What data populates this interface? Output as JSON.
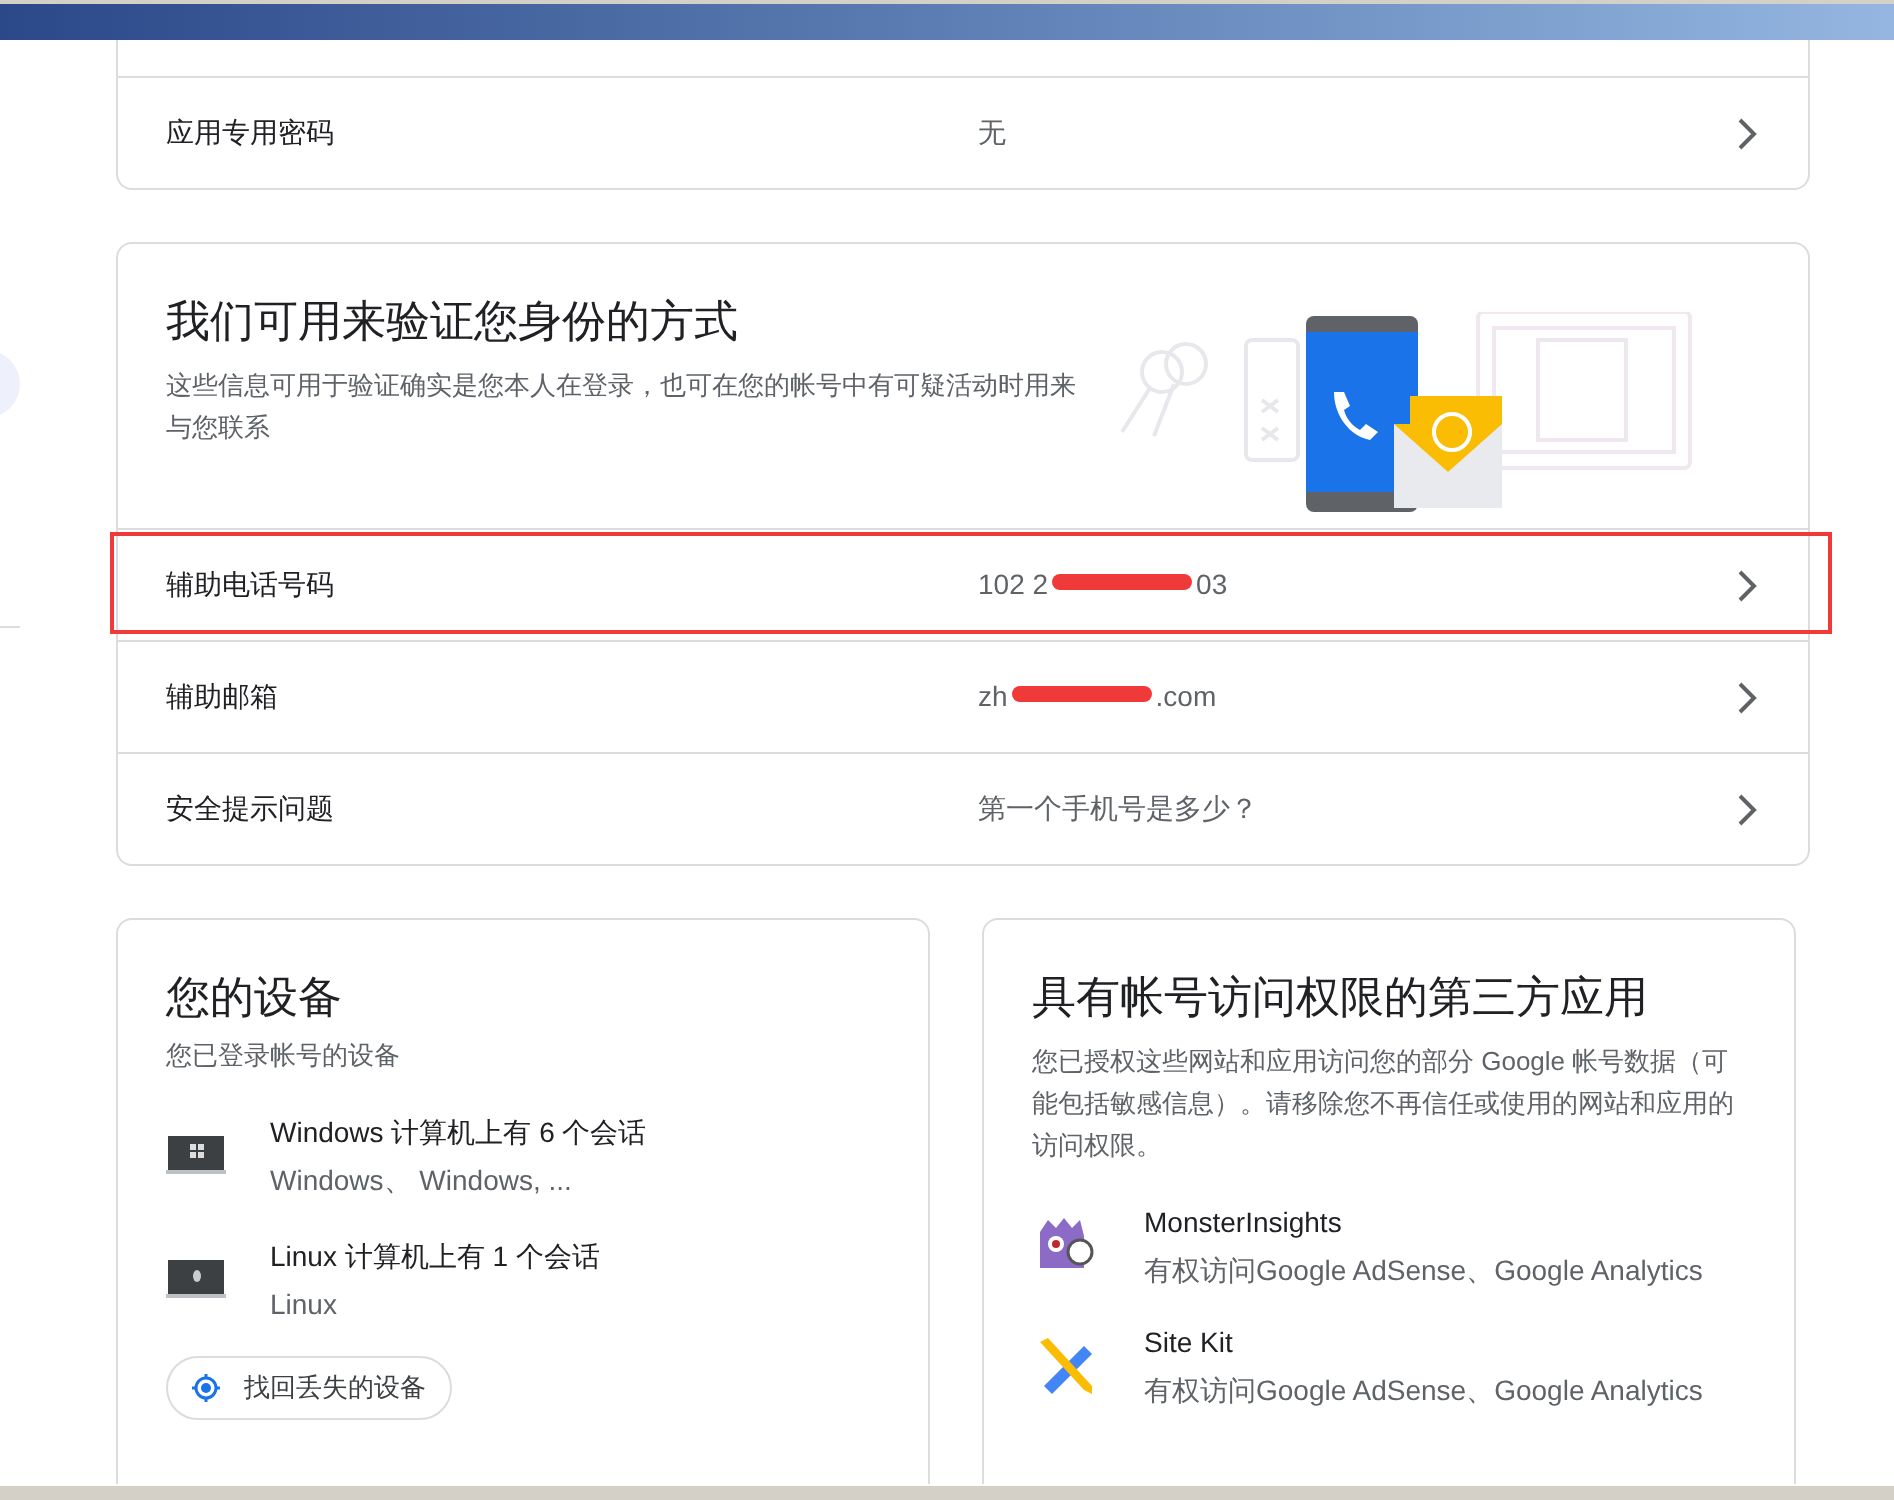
{
  "top_card": {
    "rows": [
      {
        "label": "应用专用密码",
        "value": "无"
      }
    ]
  },
  "verify_card": {
    "title": "我们可用来验证您身份的方式",
    "description": "这些信息可用于验证确实是您本人在登录，也可在您的帐号中有可疑活动时用来与您联系",
    "rows": [
      {
        "label": "辅助电话号码",
        "value_start": "102 2",
        "value_end": "03",
        "redacted": true,
        "highlighted": true
      },
      {
        "label": "辅助邮箱",
        "value_start": "zh",
        "value_end": ".com",
        "redacted": true,
        "highlighted": false
      },
      {
        "label": "安全提示问题",
        "value_start": "第一个手机号是多少？",
        "value_end": "",
        "redacted": false,
        "highlighted": false
      }
    ]
  },
  "devices_card": {
    "title": "您的设备",
    "subtitle": "您已登录帐号的设备",
    "devices": [
      {
        "kind": "windows",
        "title": "Windows 计算机上有 6 个会话",
        "detail": "Windows、 Windows, ..."
      },
      {
        "kind": "linux",
        "title": "Linux 计算机上有 1 个会话",
        "detail": "Linux"
      }
    ],
    "button": "找回丢失的设备"
  },
  "apps_card": {
    "title": "具有帐号访问权限的第三方应用",
    "description": "您已授权这些网站和应用访问您的部分 Google 帐号数据（可能包括敏感信息）。请移除您不再信任或使用的网站和应用的访问权限。",
    "apps": [
      {
        "kind": "monster",
        "name": "MonsterInsights",
        "access": "有权访问Google AdSense、Google Analytics"
      },
      {
        "kind": "sitekit",
        "name": "Site Kit",
        "access": "有权访问Google AdSense、Google Analytics"
      }
    ]
  }
}
